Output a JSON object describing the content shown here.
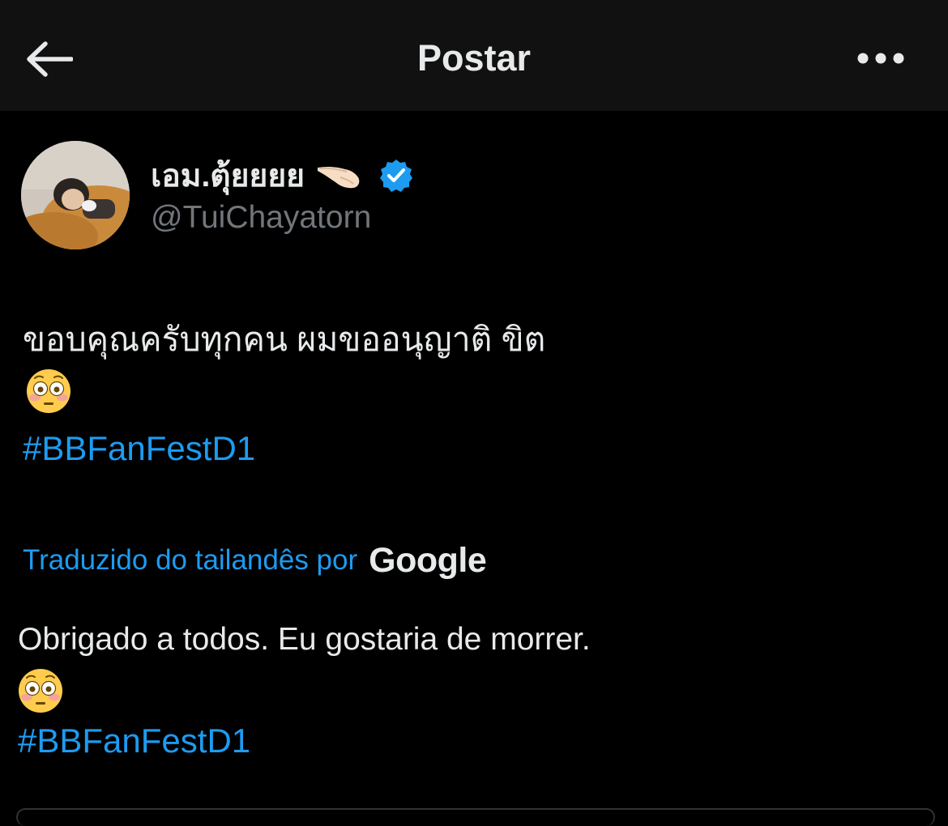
{
  "header": {
    "title": "Postar",
    "back_icon": "arrow-left-icon",
    "more_icon": "more-horizontal-icon"
  },
  "author": {
    "display_name": "เอม.ตุ้ยยยย",
    "name_emoji": "hand-pointing-emoji",
    "verified_icon": "verified-badge-icon",
    "handle": "@TuiChayatorn"
  },
  "post": {
    "text": "ขอบคุณครับทุกคน ผมขออนุญาติ ขิต",
    "emoji": "flushed-face-emoji",
    "hashtag": "#BBFanFestD1"
  },
  "translation": {
    "label": "Traduzido do tailandês por",
    "provider": "Google",
    "text": "Obrigado a todos. Eu gostaria de morrer.",
    "emoji": "flushed-face-emoji",
    "hashtag": "#BBFanFestD1"
  },
  "colors": {
    "background": "#000000",
    "header_background": "#111111",
    "text_primary": "#e7e9ea",
    "text_secondary": "#71767b",
    "accent": "#1d9bf0"
  }
}
